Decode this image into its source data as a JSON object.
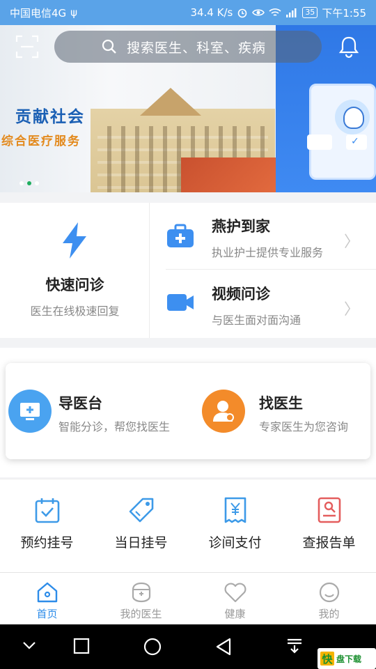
{
  "status_bar": {
    "carrier": "中国电信4G",
    "usb_symbol": "ψ",
    "speed": "34.4 K/s",
    "battery": "35",
    "time": "下午1:55"
  },
  "banner": {
    "slogan_main": "贡献社会",
    "slogan_sub": "综合医疗服务",
    "active_dot": 1,
    "dot_count": 3
  },
  "search": {
    "placeholder": "搜索医生、科室、疾病"
  },
  "services": {
    "quick_consult": {
      "title": "快速问诊",
      "subtitle": "医生在线极速回复"
    },
    "home_care": {
      "title": "燕护到家",
      "subtitle": "执业护士提供专业服务"
    },
    "video_consult": {
      "title": "视频问诊",
      "subtitle": "与医生面对面沟通"
    }
  },
  "guide": {
    "triage": {
      "title": "导医台",
      "subtitle": "智能分诊，帮您找医生"
    },
    "find_doctor": {
      "title": "找医生",
      "subtitle": "专家医生为您咨询"
    }
  },
  "quick_grid": [
    {
      "label": "预约挂号",
      "icon": "calendar-check-icon"
    },
    {
      "label": "当日挂号",
      "icon": "tag-icon"
    },
    {
      "label": "诊间支付",
      "icon": "receipt-yen-icon"
    },
    {
      "label": "查报告单",
      "icon": "report-search-icon"
    }
  ],
  "tabs": [
    {
      "label": "首页",
      "icon": "home-icon",
      "active": true
    },
    {
      "label": "我的医生",
      "icon": "doctor-icon",
      "active": false
    },
    {
      "label": "健康",
      "icon": "heart-icon",
      "active": false
    },
    {
      "label": "我的",
      "icon": "smile-icon",
      "active": false
    }
  ],
  "watermark": {
    "badge": "快",
    "text": "盘下载"
  },
  "colors": {
    "status_bar": "#5aa3e8",
    "accent": "#2d8ce9",
    "tab_inactive": "#999999",
    "triage_circle": "#4aa3f0",
    "doctor_circle": "#f38b2a"
  }
}
